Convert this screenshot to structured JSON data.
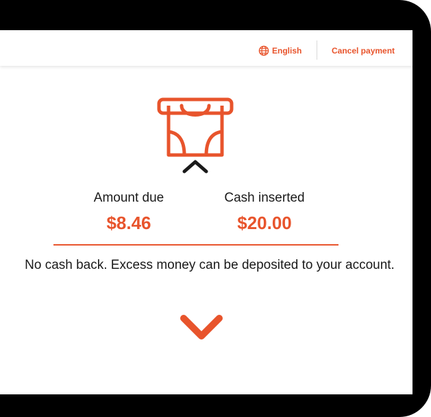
{
  "header": {
    "language_label": "English",
    "language_icon": "globe-icon",
    "cancel_label": "Cancel payment"
  },
  "payment": {
    "amount_due_label": "Amount due",
    "amount_due_value": "$8.46",
    "cash_inserted_label": "Cash inserted",
    "cash_inserted_value": "$20.00",
    "notice": "No cash back. Excess money can be deposited to your account."
  },
  "icons": {
    "cash_slot": "cash-insert-icon",
    "indicator": "chevron-up-icon",
    "scroll": "chevron-down-icon"
  },
  "colors": {
    "accent": "#e8542c",
    "text": "#1a1a1a",
    "frame": "#000000"
  }
}
